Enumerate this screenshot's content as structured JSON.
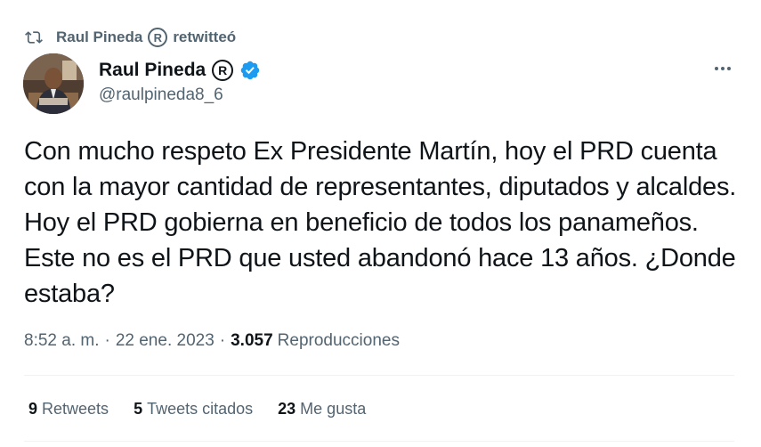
{
  "retweet_banner": {
    "icon": "retweet-icon",
    "name": "Raul Pineda",
    "badge": "R",
    "action": "retwitteó"
  },
  "author": {
    "avatar": "avatar",
    "name": "Raul Pineda",
    "badge": "R",
    "verified_icon": "verified-badge-icon",
    "verified_color": "#1d9bf0",
    "handle": "@raulpineda8_6"
  },
  "more_icon": "more-options-icon",
  "tweet": {
    "text": "Con mucho respeto Ex Presidente Martín, hoy el PRD cuenta con la mayor cantidad de representantes, diputados y alcaldes. Hoy el PRD gobierna en beneficio de todos los panameños. Este no es el PRD que usted abandonó hace 13 años. ¿Donde estaba?"
  },
  "meta": {
    "time": "8:52 a. m.",
    "separator": "·",
    "date": "22 ene. 2023",
    "views_count": "3.057",
    "views_label": "Reproducciones"
  },
  "stats": {
    "retweets_count": "9",
    "retweets_label": "Retweets",
    "quotes_count": "5",
    "quotes_label": "Tweets citados",
    "likes_count": "23",
    "likes_label": "Me gusta"
  },
  "colors": {
    "text_primary": "#0f1419",
    "text_secondary": "#536471",
    "divider": "#eff3f4"
  }
}
